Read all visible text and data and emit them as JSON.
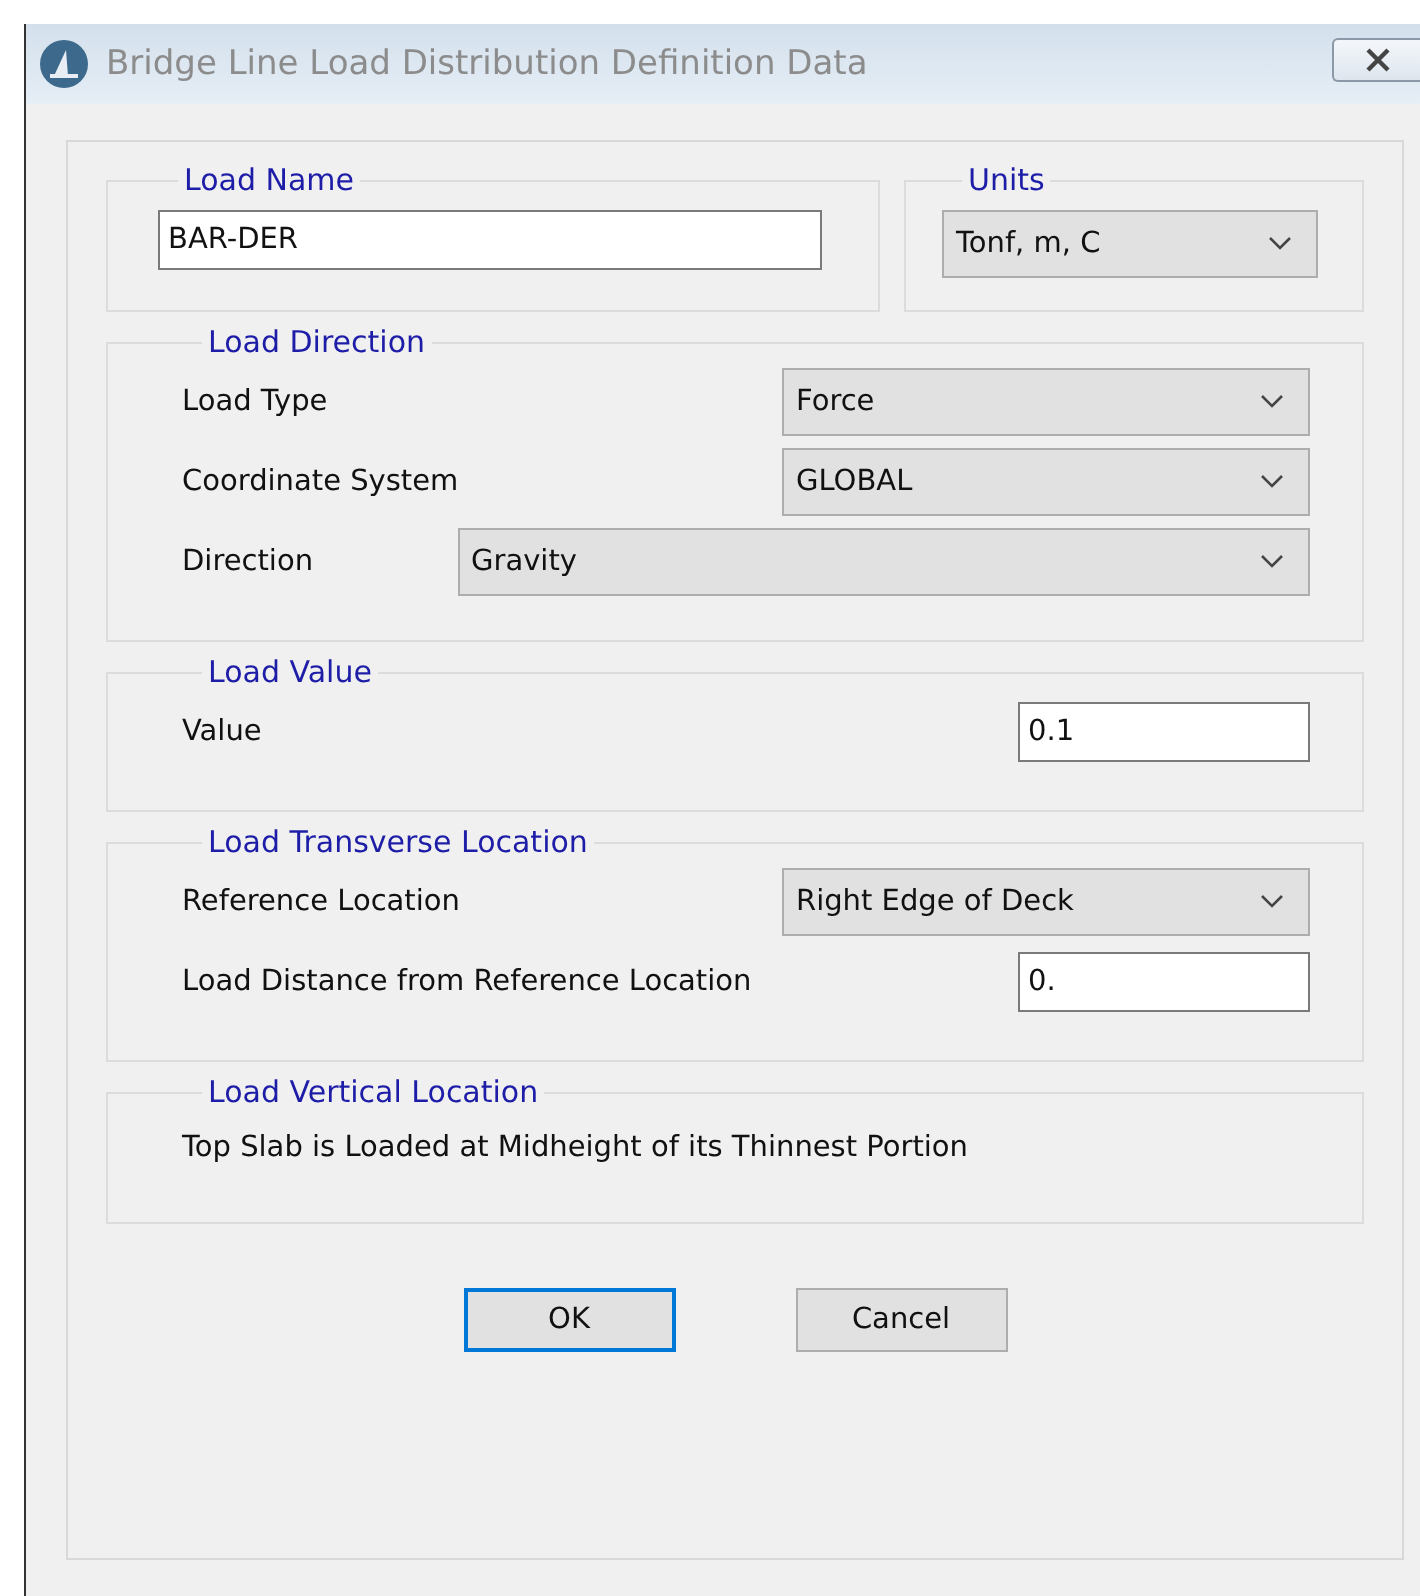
{
  "window": {
    "title": "Bridge Line Load Distribution Definition Data"
  },
  "load_name": {
    "legend": "Load Name",
    "value": "BAR-DER"
  },
  "units": {
    "legend": "Units",
    "value": "Tonf, m, C"
  },
  "groups": [
    {
      "legend": "Load Direction",
      "rows": [
        {
          "kind": "dropdown",
          "label": "Load Type",
          "value": "Force"
        },
        {
          "kind": "dropdown",
          "label": "Coordinate System",
          "value": "GLOBAL"
        },
        {
          "kind": "wide-dropdown",
          "label": "Direction",
          "value": "Gravity"
        }
      ]
    },
    {
      "legend": "Load Value",
      "rows": [
        {
          "kind": "field",
          "label": "Value",
          "value": "0.1"
        }
      ]
    },
    {
      "legend": "Load Transverse Location",
      "rows": [
        {
          "kind": "dropdown",
          "label": "Reference Location",
          "value": "Right Edge of Deck"
        },
        {
          "kind": "field",
          "label": "Load Distance from Reference Location",
          "value": "0."
        }
      ]
    },
    {
      "legend": "Load Vertical Location",
      "rows": [
        {
          "kind": "note",
          "text": "Top Slab is Loaded at Midheight of its Thinnest Portion"
        }
      ]
    }
  ],
  "buttons": [
    {
      "label": "OK",
      "default": true
    },
    {
      "label": "Cancel",
      "default": false
    }
  ]
}
